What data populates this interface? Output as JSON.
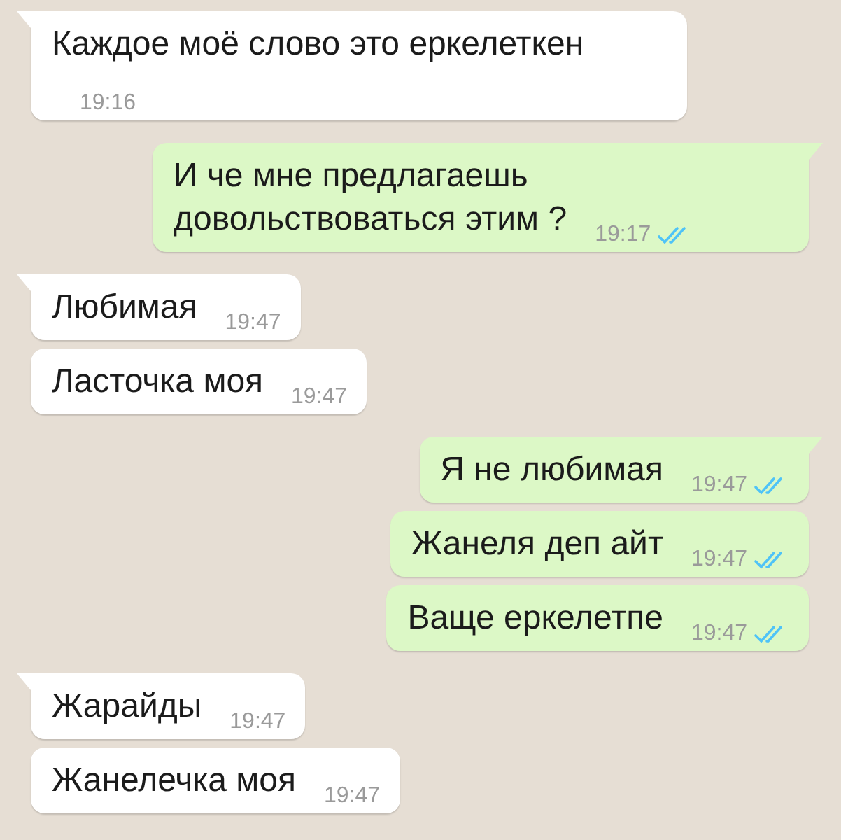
{
  "messages": [
    {
      "kind": "incoming",
      "tail": true,
      "text": "Каждое моё слово это еркелеткен",
      "time": "19:16"
    },
    {
      "kind": "outgoing",
      "tail": true,
      "text": "И че мне предлагаешь довольствоваться этим ?",
      "time": "19:17",
      "read": true
    },
    {
      "kind": "incoming",
      "tail": true,
      "text": "Любимая",
      "time": "19:47"
    },
    {
      "kind": "incoming",
      "tail": false,
      "text": "Ласточка моя",
      "time": "19:47"
    },
    {
      "kind": "outgoing",
      "tail": true,
      "text": "Я не любимая",
      "time": "19:47",
      "read": true
    },
    {
      "kind": "outgoing",
      "tail": false,
      "text": "Жанеля деп айт",
      "time": "19:47",
      "read": true
    },
    {
      "kind": "outgoing",
      "tail": false,
      "text": "Ваще еркелетпе",
      "time": "19:47",
      "read": true
    },
    {
      "kind": "incoming",
      "tail": true,
      "text": "Жарайды",
      "time": "19:47"
    },
    {
      "kind": "incoming",
      "tail": false,
      "text": "Жанелечка моя",
      "time": "19:47"
    }
  ]
}
